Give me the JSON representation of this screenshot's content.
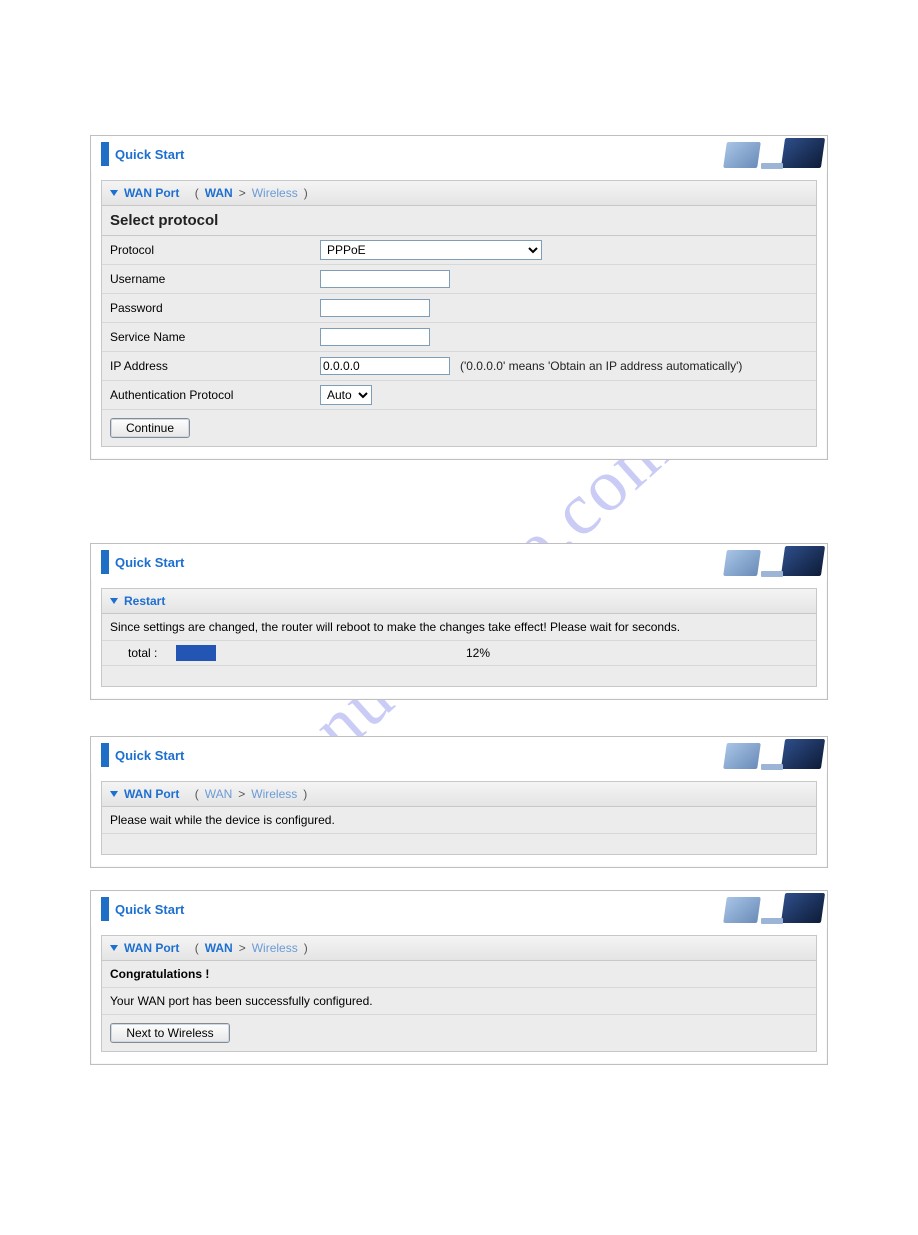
{
  "header_title": "Quick Start",
  "panel1": {
    "section_title": "WAN Port",
    "bc_paren_open": "(",
    "bc_wan": "WAN",
    "bc_sep": ">",
    "bc_wireless": "Wireless",
    "bc_paren_close": ")",
    "subheader": "Select protocol",
    "labels": {
      "protocol": "Protocol",
      "username": "Username",
      "password": "Password",
      "service_name": "Service Name",
      "ip_address": "IP Address",
      "auth_proto": "Authentication Protocol"
    },
    "values": {
      "protocol_option": "PPPoE",
      "username": "",
      "password": "",
      "service_name": "",
      "ip_address": "0.0.0.0",
      "auth_option": "Auto"
    },
    "ip_hint": "('0.0.0.0' means 'Obtain an IP address automatically')",
    "continue_btn": "Continue"
  },
  "panel2": {
    "section_title": "Restart",
    "message": "Since settings are changed, the router will reboot to make the changes take effect! Please wait for seconds.",
    "progress_label": "total :",
    "progress_text": "12%"
  },
  "panel3": {
    "section_title": "WAN Port",
    "bc_paren_open": "(",
    "bc_wan": "WAN",
    "bc_sep": ">",
    "bc_wireless": "Wireless",
    "bc_paren_close": ")",
    "message": "Please wait while the device is configured."
  },
  "panel4": {
    "section_title": "WAN Port",
    "bc_paren_open": "(",
    "bc_wan": "WAN",
    "bc_sep": ">",
    "bc_wireless": "Wireless",
    "bc_paren_close": ")",
    "congrats": "Congratulations !",
    "message": "Your WAN port has been successfully configured.",
    "next_btn": "Next to Wireless"
  },
  "watermark": "manualshive.com"
}
